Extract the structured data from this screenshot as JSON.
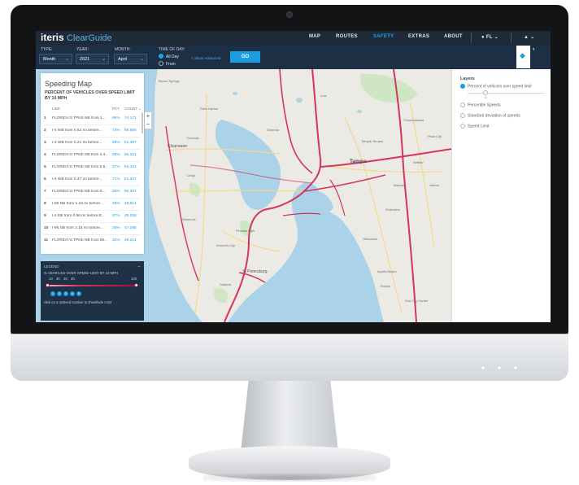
{
  "header": {
    "logo_main": "iteris",
    "logo_sub": "ClearGuide",
    "nav": [
      "MAP",
      "ROUTES",
      "SAFETY",
      "EXTRAS",
      "ABOUT"
    ],
    "active_nav": "SAFETY",
    "state": "FL"
  },
  "filters": {
    "type_label": "TYPE:",
    "type_value": "Month",
    "year_label": "YEAR:",
    "year_value": "2021",
    "month_label": "MONTH:",
    "month_value": "April",
    "time_label": "TIME OF DAY:",
    "time_all": "All Day",
    "time_from": "From",
    "advanced": "+ Show Advanced",
    "go": "GO"
  },
  "panel": {
    "title": "Speeding Map",
    "subtitle": "PERCENT OF VEHICLES OVER SPEED LIMIT BY 10 MPH",
    "col_link": "LINK",
    "col_pct": "PCT",
    "col_count": "COUNT",
    "rows": [
      {
        "n": "1",
        "link": "FLORIDA'S TPKE NB from 1...",
        "pct": "96%",
        "count": "74,171"
      },
      {
        "n": "2",
        "link": "I-4 WB from 0.62 mi before...",
        "pct": "73%",
        "count": "69,680"
      },
      {
        "n": "3",
        "link": "I-4 WB from 0.21 mi before...",
        "pct": "69%",
        "count": "61,397"
      },
      {
        "n": "4",
        "link": "FLORIDA'S TPKE SB from 4.4...",
        "pct": "25%",
        "count": "55,151"
      },
      {
        "n": "5",
        "link": "FLORIDA'S TPKE SB from 5.5...",
        "pct": "27%",
        "count": "54,422"
      },
      {
        "n": "6",
        "link": "I-4 WB from 0.47 mi before...",
        "pct": "71%",
        "count": "51,337"
      },
      {
        "n": "7",
        "link": "FLORIDA'S TPKE NB from 5...",
        "pct": "25%",
        "count": "50,337"
      },
      {
        "n": "8",
        "link": "I-95 NB from 1.18 mi before...",
        "pct": "49%",
        "count": "49,614"
      },
      {
        "n": "9",
        "link": "I-4 EB from 0.56 mi before E...",
        "pct": "57%",
        "count": "49,255"
      },
      {
        "n": "10",
        "link": "I-95 SB from 3.15 mi before...",
        "pct": "25%",
        "count": "47,296"
      },
      {
        "n": "11",
        "link": "FLORIDA'S TPKE NB from Ell...",
        "pct": "32%",
        "count": "45,214"
      }
    ]
  },
  "legend": {
    "title": "LEGEND",
    "subtitle": "% VEHICLES OVER SPEED LIMIT BY 10 MPH",
    "ticks": [
      "10",
      "20",
      "30",
      "40"
    ],
    "max": "100",
    "numbers": [
      "1",
      "2",
      "3",
      "4",
      "5"
    ],
    "hint": "click on a ordered number to show/hide color"
  },
  "layers": {
    "title": "Layers",
    "items": [
      "Percent of vehicles over speed limit",
      "Percentile Speeds",
      "Standard deviation of speeds",
      "Speed Limit"
    ],
    "slider_mid": "10"
  },
  "map_labels": {
    "tampa": "Tampa",
    "clearwater": "Clearwater",
    "st_petersburg": "St Petersburg",
    "largo": "Largo",
    "pinellas_park": "Pinellas Park",
    "brandon": "Brandon",
    "dunedin": "Dunedin",
    "palm_harbor": "Palm Harbor",
    "oldsmar": "Oldsmar",
    "temple_terrace": "Temple Terrace",
    "lutz": "Lutz",
    "riverview": "Riverview",
    "apollo_beach": "Apollo Beach",
    "ruskin": "Ruskin",
    "sun_city_center": "Sun City Center",
    "gibsonton": "Gibsonton",
    "kenneth_city": "Kenneth City",
    "seminole": "Seminole",
    "gulfport": "Gulfport",
    "thonotosassa": "Thonotosassa",
    "seffner": "Seffner",
    "valrico": "Valrico",
    "plant_city": "Plant City",
    "tarpon": "Tarpon Springs"
  },
  "colors": {
    "header_bg": "#1e2a38",
    "filter_bg": "#1d2f44",
    "accent": "#1b9de2",
    "road_red": "#d6335e",
    "water": "#aad3ea"
  }
}
